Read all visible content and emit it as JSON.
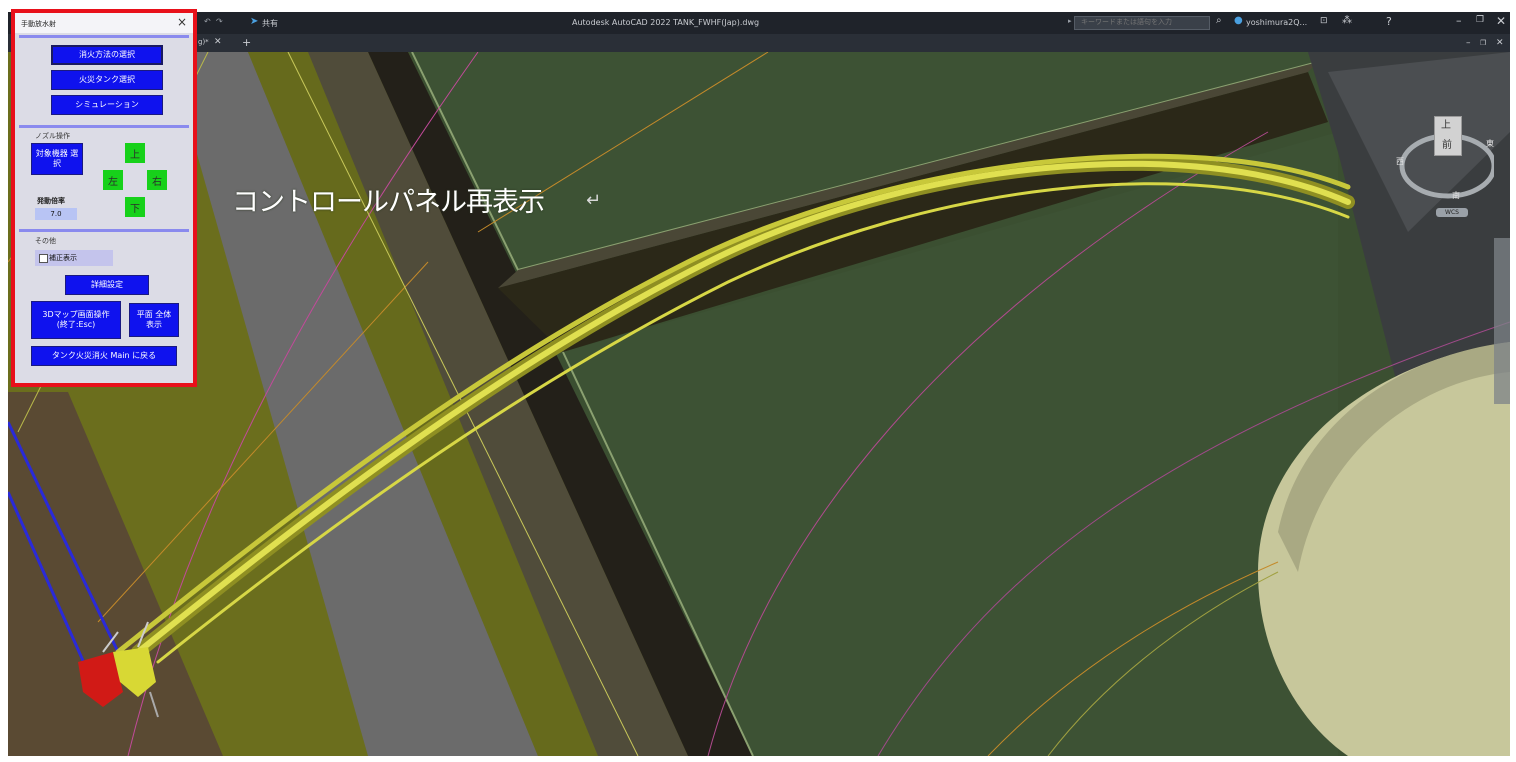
{
  "app": {
    "title": "Autodesk AutoCAD 2022   TANK_FWHF(Jap).dwg",
    "share_label": "共有",
    "search_placeholder": "キーワードまたは語句を入力",
    "user_name": "yoshimura2Q...",
    "tab_label": "g)*"
  },
  "overlay": {
    "label": "コントロールパネル再表示",
    "return_mark": "↵"
  },
  "panel": {
    "title": "手動放水射",
    "close": "×",
    "buttons": {
      "method": "消火方法の選択",
      "tank": "火災タンク選択",
      "simulation": "シミュレーション"
    },
    "nozzle_group": "ノズル操作",
    "target_btn": "対象機器 選択",
    "dirs": {
      "up": "上",
      "left": "左",
      "right": "右",
      "down": "下"
    },
    "nudge_label": "発動倍率",
    "nudge_value": "7.0",
    "other_group": "その他",
    "checkbox_label": "補正表示",
    "detail_btn": "詳細設定",
    "map_btn": "3Dマップ画面操作 (終了:Esc)",
    "plan_btn": "平面 全体表示",
    "back_btn": "タンク火災消火 Main に戻る"
  },
  "viewcube": {
    "top": "上",
    "front": "前",
    "west": "西",
    "east": "東",
    "south": "南",
    "wcs": "WCS"
  },
  "colors": {
    "panel_border": "#e8101a",
    "button_blue": "#0f12ee",
    "arrow_green": "#17d11a",
    "ground_green": "#3b4f31",
    "stream_yellow": "#e0e050"
  }
}
